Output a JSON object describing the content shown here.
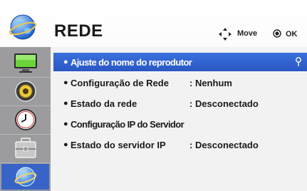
{
  "header": {
    "title": "REDE",
    "hint_move": "Move",
    "hint_ok": "OK"
  },
  "sidebar": {
    "items": [
      {
        "icon": "monitor-icon"
      },
      {
        "icon": "speaker-icon"
      },
      {
        "icon": "clock-icon"
      },
      {
        "icon": "toolbox-icon"
      },
      {
        "icon": "globe-icon",
        "active": true
      }
    ]
  },
  "menu": {
    "items": [
      {
        "label": "Ajuste do nome do reprodutor",
        "value": "",
        "selected": true
      },
      {
        "label": "Configuração de Rede",
        "value": ": Nenhum"
      },
      {
        "label": "Estado da rede",
        "value": ": Desconectado"
      },
      {
        "label": "Configuração IP do Servidor",
        "value": ""
      },
      {
        "label": "Estado do servidor IP",
        "value": ": Desconectado"
      }
    ]
  },
  "colors": {
    "selected_row": "#2f62d2",
    "sidebar_active": "#3864c7",
    "sidebar_bg": "#9c9c9e"
  }
}
